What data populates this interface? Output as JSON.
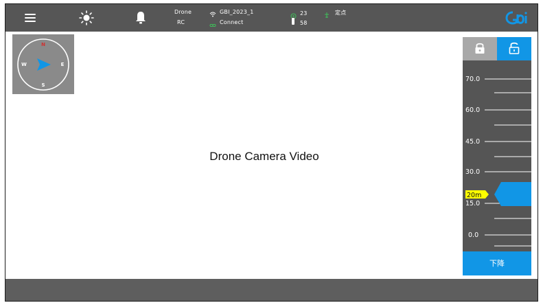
{
  "topbar": {
    "drone_label": "Drone",
    "rc_label": "RC",
    "network_name": "GBI_2023_1",
    "connection_status": "Connect",
    "satellite_count": "23",
    "battery_value": "58",
    "flight_mode": "定点",
    "icons": [
      "menu-icon",
      "brightness-icon",
      "bell-icon",
      "wifi-icon",
      "link-icon",
      "satellite-icon",
      "battery-icon",
      "drone-icon",
      "gbi-logo"
    ],
    "accent_green": "#3fbf5a",
    "logo_color": "#1196e6"
  },
  "compass": {
    "north": "N",
    "south": "S",
    "east": "E",
    "west": "W",
    "north_color": "#d03030",
    "heading_color": "#1196e6"
  },
  "video": {
    "label": "Drone Camera Video"
  },
  "altitude_panel": {
    "scale_labels": [
      "70.0",
      "60.0",
      "45.0",
      "30.0",
      "15.0",
      "0.0"
    ],
    "current_altitude": "20m",
    "descend_label": "下降",
    "lock_left": "lock-icon",
    "lock_right": "unlock-icon",
    "accent": "#1196e6",
    "indicator_color": "#ffff00"
  }
}
